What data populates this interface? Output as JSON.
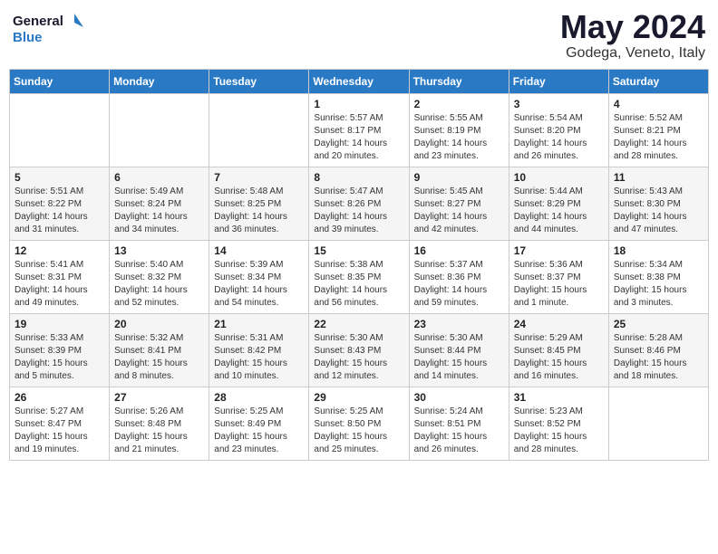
{
  "header": {
    "logo_line1": "General",
    "logo_line2": "Blue",
    "month_title": "May 2024",
    "location": "Godega, Veneto, Italy"
  },
  "weekdays": [
    "Sunday",
    "Monday",
    "Tuesday",
    "Wednesday",
    "Thursday",
    "Friday",
    "Saturday"
  ],
  "weeks": [
    [
      {
        "day": "",
        "info": ""
      },
      {
        "day": "",
        "info": ""
      },
      {
        "day": "",
        "info": ""
      },
      {
        "day": "1",
        "info": "Sunrise: 5:57 AM\nSunset: 8:17 PM\nDaylight: 14 hours\nand 20 minutes."
      },
      {
        "day": "2",
        "info": "Sunrise: 5:55 AM\nSunset: 8:19 PM\nDaylight: 14 hours\nand 23 minutes."
      },
      {
        "day": "3",
        "info": "Sunrise: 5:54 AM\nSunset: 8:20 PM\nDaylight: 14 hours\nand 26 minutes."
      },
      {
        "day": "4",
        "info": "Sunrise: 5:52 AM\nSunset: 8:21 PM\nDaylight: 14 hours\nand 28 minutes."
      }
    ],
    [
      {
        "day": "5",
        "info": "Sunrise: 5:51 AM\nSunset: 8:22 PM\nDaylight: 14 hours\nand 31 minutes."
      },
      {
        "day": "6",
        "info": "Sunrise: 5:49 AM\nSunset: 8:24 PM\nDaylight: 14 hours\nand 34 minutes."
      },
      {
        "day": "7",
        "info": "Sunrise: 5:48 AM\nSunset: 8:25 PM\nDaylight: 14 hours\nand 36 minutes."
      },
      {
        "day": "8",
        "info": "Sunrise: 5:47 AM\nSunset: 8:26 PM\nDaylight: 14 hours\nand 39 minutes."
      },
      {
        "day": "9",
        "info": "Sunrise: 5:45 AM\nSunset: 8:27 PM\nDaylight: 14 hours\nand 42 minutes."
      },
      {
        "day": "10",
        "info": "Sunrise: 5:44 AM\nSunset: 8:29 PM\nDaylight: 14 hours\nand 44 minutes."
      },
      {
        "day": "11",
        "info": "Sunrise: 5:43 AM\nSunset: 8:30 PM\nDaylight: 14 hours\nand 47 minutes."
      }
    ],
    [
      {
        "day": "12",
        "info": "Sunrise: 5:41 AM\nSunset: 8:31 PM\nDaylight: 14 hours\nand 49 minutes."
      },
      {
        "day": "13",
        "info": "Sunrise: 5:40 AM\nSunset: 8:32 PM\nDaylight: 14 hours\nand 52 minutes."
      },
      {
        "day": "14",
        "info": "Sunrise: 5:39 AM\nSunset: 8:34 PM\nDaylight: 14 hours\nand 54 minutes."
      },
      {
        "day": "15",
        "info": "Sunrise: 5:38 AM\nSunset: 8:35 PM\nDaylight: 14 hours\nand 56 minutes."
      },
      {
        "day": "16",
        "info": "Sunrise: 5:37 AM\nSunset: 8:36 PM\nDaylight: 14 hours\nand 59 minutes."
      },
      {
        "day": "17",
        "info": "Sunrise: 5:36 AM\nSunset: 8:37 PM\nDaylight: 15 hours\nand 1 minute."
      },
      {
        "day": "18",
        "info": "Sunrise: 5:34 AM\nSunset: 8:38 PM\nDaylight: 15 hours\nand 3 minutes."
      }
    ],
    [
      {
        "day": "19",
        "info": "Sunrise: 5:33 AM\nSunset: 8:39 PM\nDaylight: 15 hours\nand 5 minutes."
      },
      {
        "day": "20",
        "info": "Sunrise: 5:32 AM\nSunset: 8:41 PM\nDaylight: 15 hours\nand 8 minutes."
      },
      {
        "day": "21",
        "info": "Sunrise: 5:31 AM\nSunset: 8:42 PM\nDaylight: 15 hours\nand 10 minutes."
      },
      {
        "day": "22",
        "info": "Sunrise: 5:30 AM\nSunset: 8:43 PM\nDaylight: 15 hours\nand 12 minutes."
      },
      {
        "day": "23",
        "info": "Sunrise: 5:30 AM\nSunset: 8:44 PM\nDaylight: 15 hours\nand 14 minutes."
      },
      {
        "day": "24",
        "info": "Sunrise: 5:29 AM\nSunset: 8:45 PM\nDaylight: 15 hours\nand 16 minutes."
      },
      {
        "day": "25",
        "info": "Sunrise: 5:28 AM\nSunset: 8:46 PM\nDaylight: 15 hours\nand 18 minutes."
      }
    ],
    [
      {
        "day": "26",
        "info": "Sunrise: 5:27 AM\nSunset: 8:47 PM\nDaylight: 15 hours\nand 19 minutes."
      },
      {
        "day": "27",
        "info": "Sunrise: 5:26 AM\nSunset: 8:48 PM\nDaylight: 15 hours\nand 21 minutes."
      },
      {
        "day": "28",
        "info": "Sunrise: 5:25 AM\nSunset: 8:49 PM\nDaylight: 15 hours\nand 23 minutes."
      },
      {
        "day": "29",
        "info": "Sunrise: 5:25 AM\nSunset: 8:50 PM\nDaylight: 15 hours\nand 25 minutes."
      },
      {
        "day": "30",
        "info": "Sunrise: 5:24 AM\nSunset: 8:51 PM\nDaylight: 15 hours\nand 26 minutes."
      },
      {
        "day": "31",
        "info": "Sunrise: 5:23 AM\nSunset: 8:52 PM\nDaylight: 15 hours\nand 28 minutes."
      },
      {
        "day": "",
        "info": ""
      }
    ]
  ]
}
